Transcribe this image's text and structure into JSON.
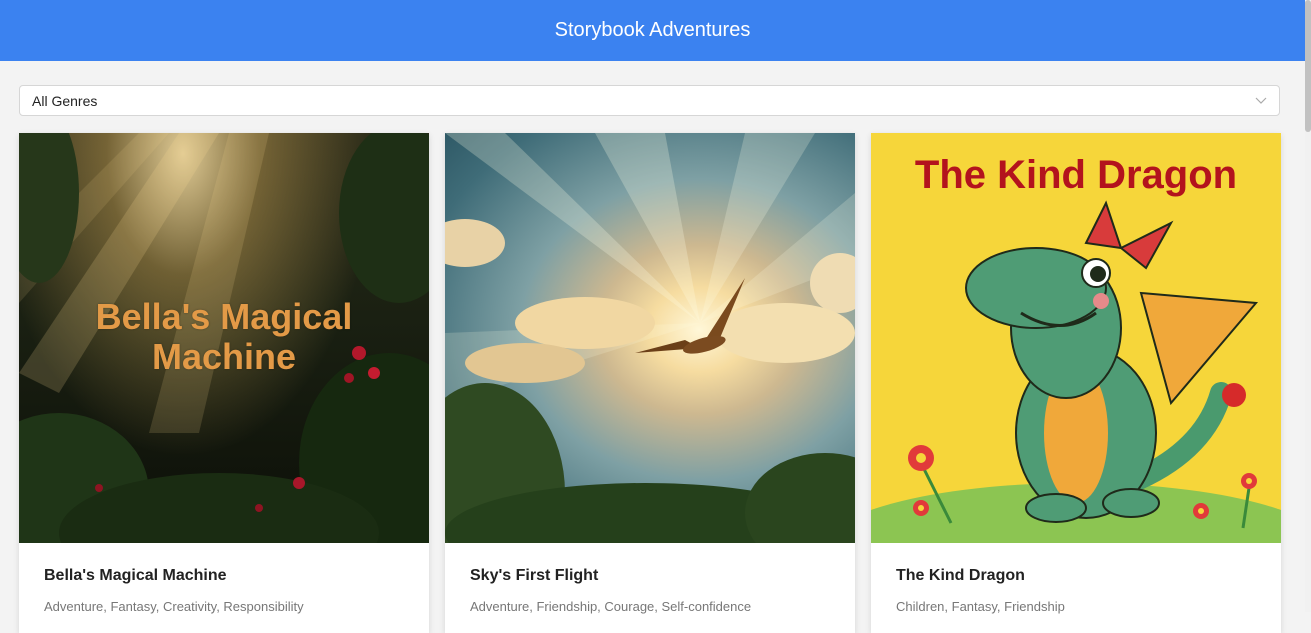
{
  "header": {
    "title": "Storybook Adventures"
  },
  "filter": {
    "selected": "All Genres",
    "icon": "chevron-down-icon"
  },
  "books": [
    {
      "title": "Bella's Magical Machine",
      "tags": "Adventure, Fantasy, Creativity, Responsibility",
      "cover_text": "Bella's Magical Machine"
    },
    {
      "title": "Sky's First Flight",
      "tags": "Adventure, Friendship, Courage, Self-confidence"
    },
    {
      "title": "The Kind Dragon",
      "tags": "Children, Fantasy, Friendship",
      "cover_text": "The Kind Dragon"
    }
  ],
  "colors": {
    "header_bg": "#3b82f0",
    "page_bg": "#f3f3f3"
  }
}
